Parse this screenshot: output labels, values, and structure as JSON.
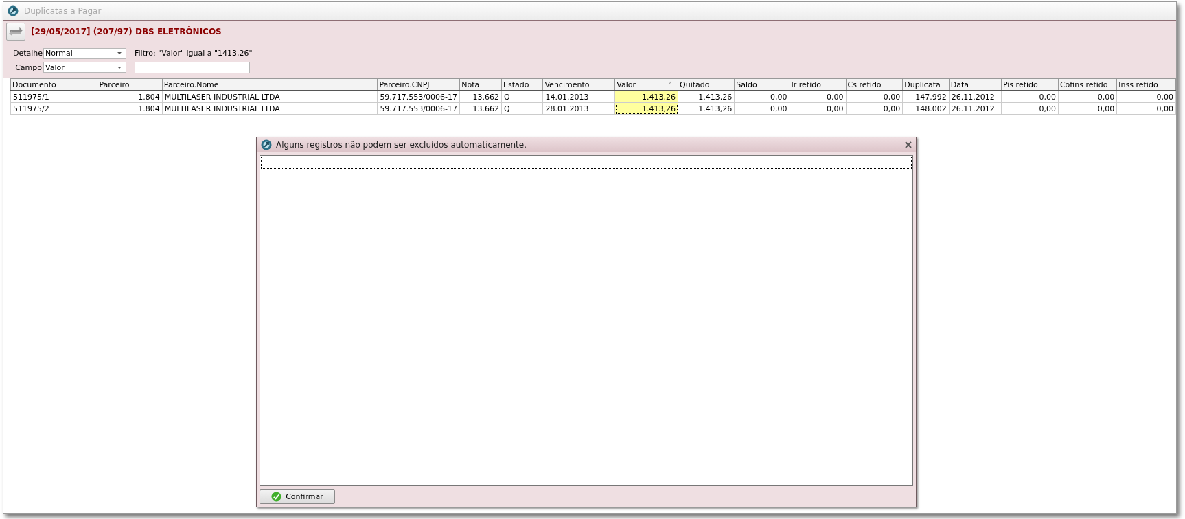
{
  "window": {
    "title": "Duplicatas a Pagar"
  },
  "header": {
    "title": "[29/05/2017] (207/97) DBS ELETRÔNICOS"
  },
  "filters": {
    "detalhe": {
      "label": "Detalhe",
      "value": "Normal"
    },
    "campo": {
      "label": "Campo",
      "value": "Valor"
    },
    "filter_text": "Filtro: \"Valor\" igual a \"1413,26\""
  },
  "table": {
    "columns": [
      {
        "label": "Documento",
        "kind": "text",
        "highlighted": false,
        "sorted": false
      },
      {
        "label": "Parceiro",
        "kind": "number",
        "highlighted": false,
        "sorted": false
      },
      {
        "label": "Parceiro.Nome",
        "kind": "text",
        "highlighted": false,
        "sorted": false
      },
      {
        "label": "Parceiro.CNPJ",
        "kind": "text",
        "highlighted": false,
        "sorted": false
      },
      {
        "label": "Nota",
        "kind": "number",
        "highlighted": false,
        "sorted": false
      },
      {
        "label": "Estado",
        "kind": "text",
        "highlighted": false,
        "sorted": false
      },
      {
        "label": "Vencimento",
        "kind": "text",
        "highlighted": false,
        "sorted": false
      },
      {
        "label": "Valor",
        "kind": "number",
        "highlighted": true,
        "sorted": true
      },
      {
        "label": "Quitado",
        "kind": "number",
        "highlighted": false,
        "sorted": false
      },
      {
        "label": "Saldo",
        "kind": "number",
        "highlighted": false,
        "sorted": false
      },
      {
        "label": "Ir retido",
        "kind": "number",
        "highlighted": false,
        "sorted": false
      },
      {
        "label": "Cs retido",
        "kind": "number",
        "highlighted": false,
        "sorted": false
      },
      {
        "label": "Duplicata",
        "kind": "number",
        "highlighted": false,
        "sorted": false
      },
      {
        "label": "Data",
        "kind": "text",
        "highlighted": false,
        "sorted": false
      },
      {
        "label": "Pis retido",
        "kind": "number",
        "highlighted": false,
        "sorted": false
      },
      {
        "label": "Cofins retido",
        "kind": "number",
        "highlighted": false,
        "sorted": false
      },
      {
        "label": "Inss retido",
        "kind": "number",
        "highlighted": false,
        "sorted": false
      }
    ],
    "rows": [
      {
        "focused": false,
        "cells": [
          "511975/1",
          "1.804",
          "MULTILASER INDUSTRIAL LTDA",
          "59.717.553/0006-17",
          "13.662",
          "Q",
          "14.01.2013",
          "1.413,26",
          "1.413,26",
          "0,00",
          "0,00",
          "0,00",
          "147.992",
          "26.11.2012",
          "0,00",
          "0,00",
          "0,00"
        ]
      },
      {
        "focused": true,
        "cells": [
          "511975/2",
          "1.804",
          "MULTILASER INDUSTRIAL LTDA",
          "59.717.553/0006-17",
          "13.662",
          "Q",
          "28.01.2013",
          "1.413,26",
          "1.413,26",
          "0,00",
          "0,00",
          "0,00",
          "148.002",
          "26.11.2012",
          "0,00",
          "0,00",
          "0,00"
        ]
      }
    ]
  },
  "dialog": {
    "title": "Alguns registros não podem ser excluídos automaticamente.",
    "button": "Confirmar"
  }
}
